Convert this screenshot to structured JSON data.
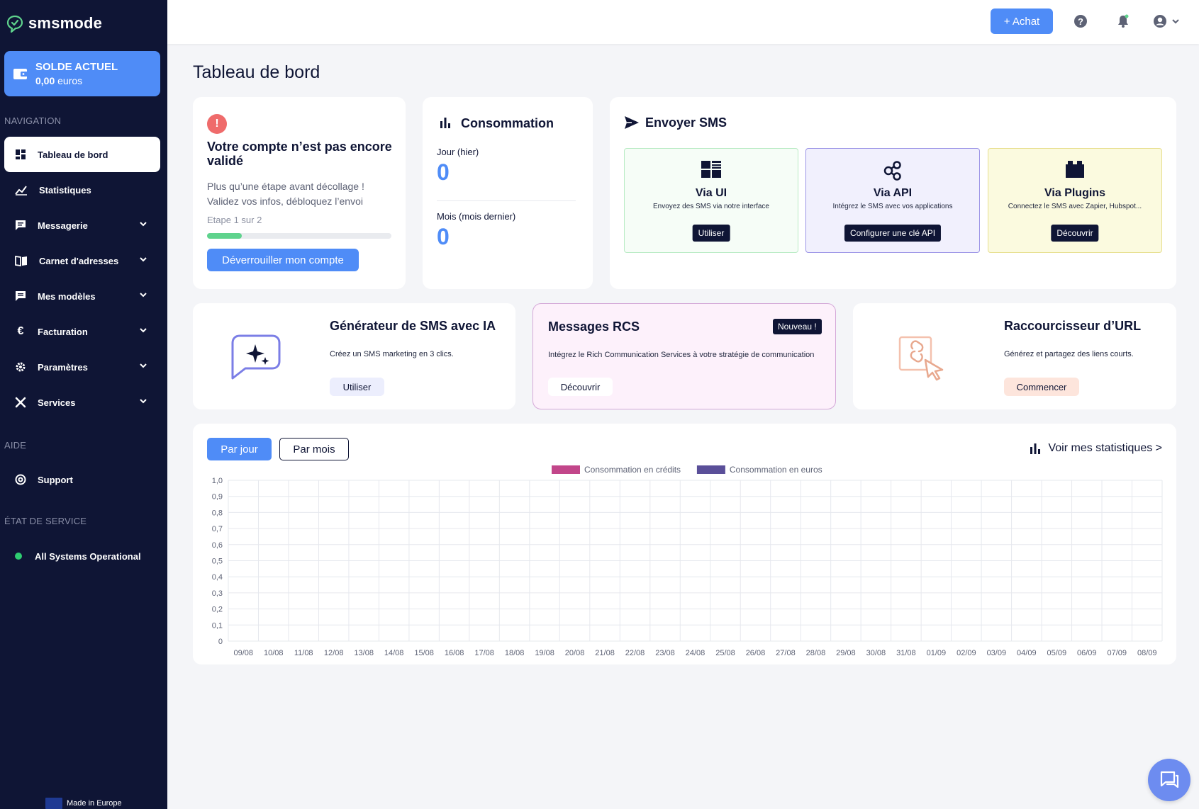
{
  "brand": {
    "name": "smsmode"
  },
  "balance": {
    "title": "SOLDE ACTUEL",
    "amount": "0,00",
    "unit": "euros"
  },
  "sidebar": {
    "nav_label": "NAVIGATION",
    "items": [
      {
        "label": "Tableau de bord",
        "icon": "dashboard-icon"
      },
      {
        "label": "Statistiques",
        "icon": "stats-icon"
      },
      {
        "label": "Messagerie",
        "icon": "chat-icon"
      },
      {
        "label": "Carnet d'adresses",
        "icon": "book-icon"
      },
      {
        "label": "Mes modèles",
        "icon": "template-icon"
      },
      {
        "label": "Facturation",
        "icon": "euro-icon"
      },
      {
        "label": "Paramètres",
        "icon": "gear-icon"
      },
      {
        "label": "Services",
        "icon": "tools-icon"
      }
    ],
    "help_label": "AIDE",
    "support_label": "Support",
    "status_label": "ÉTAT DE SERVICE",
    "status_text": "All Systems Operational",
    "made_in": "Made in Europe"
  },
  "topbar": {
    "buy_label": "+ Achat"
  },
  "page": {
    "title": "Tableau de bord"
  },
  "account": {
    "title": "Votre compte n’est pas encore validé",
    "line1": "Plus qu’une étape avant décollage !",
    "line2": "Validez vos infos, débloquez l’envoi",
    "step": "Etape 1 sur 2",
    "progress": 0.19,
    "button": "Déverrouiller mon compte"
  },
  "consumption": {
    "title": "Consommation",
    "day_label": "Jour (hier)",
    "day_value": "0",
    "month_label": "Mois (mois dernier)",
    "month_value": "0"
  },
  "send": {
    "title": "Envoyer SMS",
    "methods": [
      {
        "title": "Via UI",
        "desc": "Envoyez des SMS via notre interface",
        "button": "Utiliser",
        "bg": "#f6fdf7",
        "border": "#b8ebc4"
      },
      {
        "title": "Via API",
        "desc": "Intégrez le SMS avec vos applications",
        "button": "Configurer une clé API",
        "bg": "#f1f0fd",
        "border": "#9b94e6"
      },
      {
        "title": "Via Plugins",
        "desc": "Connectez le SMS avec Zapier, Hubspot...",
        "button": "Découvrir",
        "bg": "#fbfadf",
        "border": "#e7df8f"
      }
    ]
  },
  "ai": {
    "title": "Générateur de SMS avec IA",
    "desc": "Créez un SMS marketing en 3 clics.",
    "button": "Utiliser"
  },
  "rcs": {
    "title": "Messages RCS",
    "badge": "Nouveau !",
    "desc": "Intégrez le Rich Communication Services à votre stratégie de communication",
    "button": "Découvrir"
  },
  "url": {
    "title": "Raccourcisseur d’URL",
    "desc": "Générez et partagez des liens courts.",
    "button": "Commencer"
  },
  "stats": {
    "tab_day": "Par jour",
    "tab_month": "Par mois",
    "link": "Voir mes statistiques >"
  },
  "chart_data": {
    "type": "bar",
    "categories": [
      "09/08",
      "10/08",
      "11/08",
      "12/08",
      "13/08",
      "14/08",
      "15/08",
      "16/08",
      "17/08",
      "18/08",
      "19/08",
      "20/08",
      "21/08",
      "22/08",
      "23/08",
      "24/08",
      "25/08",
      "26/08",
      "27/08",
      "28/08",
      "29/08",
      "30/08",
      "31/08",
      "01/09",
      "02/09",
      "03/09",
      "04/09",
      "05/09",
      "06/09",
      "07/09",
      "08/09"
    ],
    "series": [
      {
        "name": "Consommation en crédits",
        "color": "#c2468a",
        "values": [
          0,
          0,
          0,
          0,
          0,
          0,
          0,
          0,
          0,
          0,
          0,
          0,
          0,
          0,
          0,
          0,
          0,
          0,
          0,
          0,
          0,
          0,
          0,
          0,
          0,
          0,
          0,
          0,
          0,
          0,
          0
        ]
      },
      {
        "name": "Consommation en euros",
        "color": "#5a4f99",
        "values": [
          0,
          0,
          0,
          0,
          0,
          0,
          0,
          0,
          0,
          0,
          0,
          0,
          0,
          0,
          0,
          0,
          0,
          0,
          0,
          0,
          0,
          0,
          0,
          0,
          0,
          0,
          0,
          0,
          0,
          0,
          0
        ]
      }
    ],
    "y_ticks": [
      "1,0",
      "0,9",
      "0,8",
      "0,7",
      "0,6",
      "0,5",
      "0,4",
      "0,3",
      "0,2",
      "0,1",
      "0"
    ],
    "ylim": [
      0,
      1
    ],
    "grid": true,
    "legend": "top-center"
  }
}
